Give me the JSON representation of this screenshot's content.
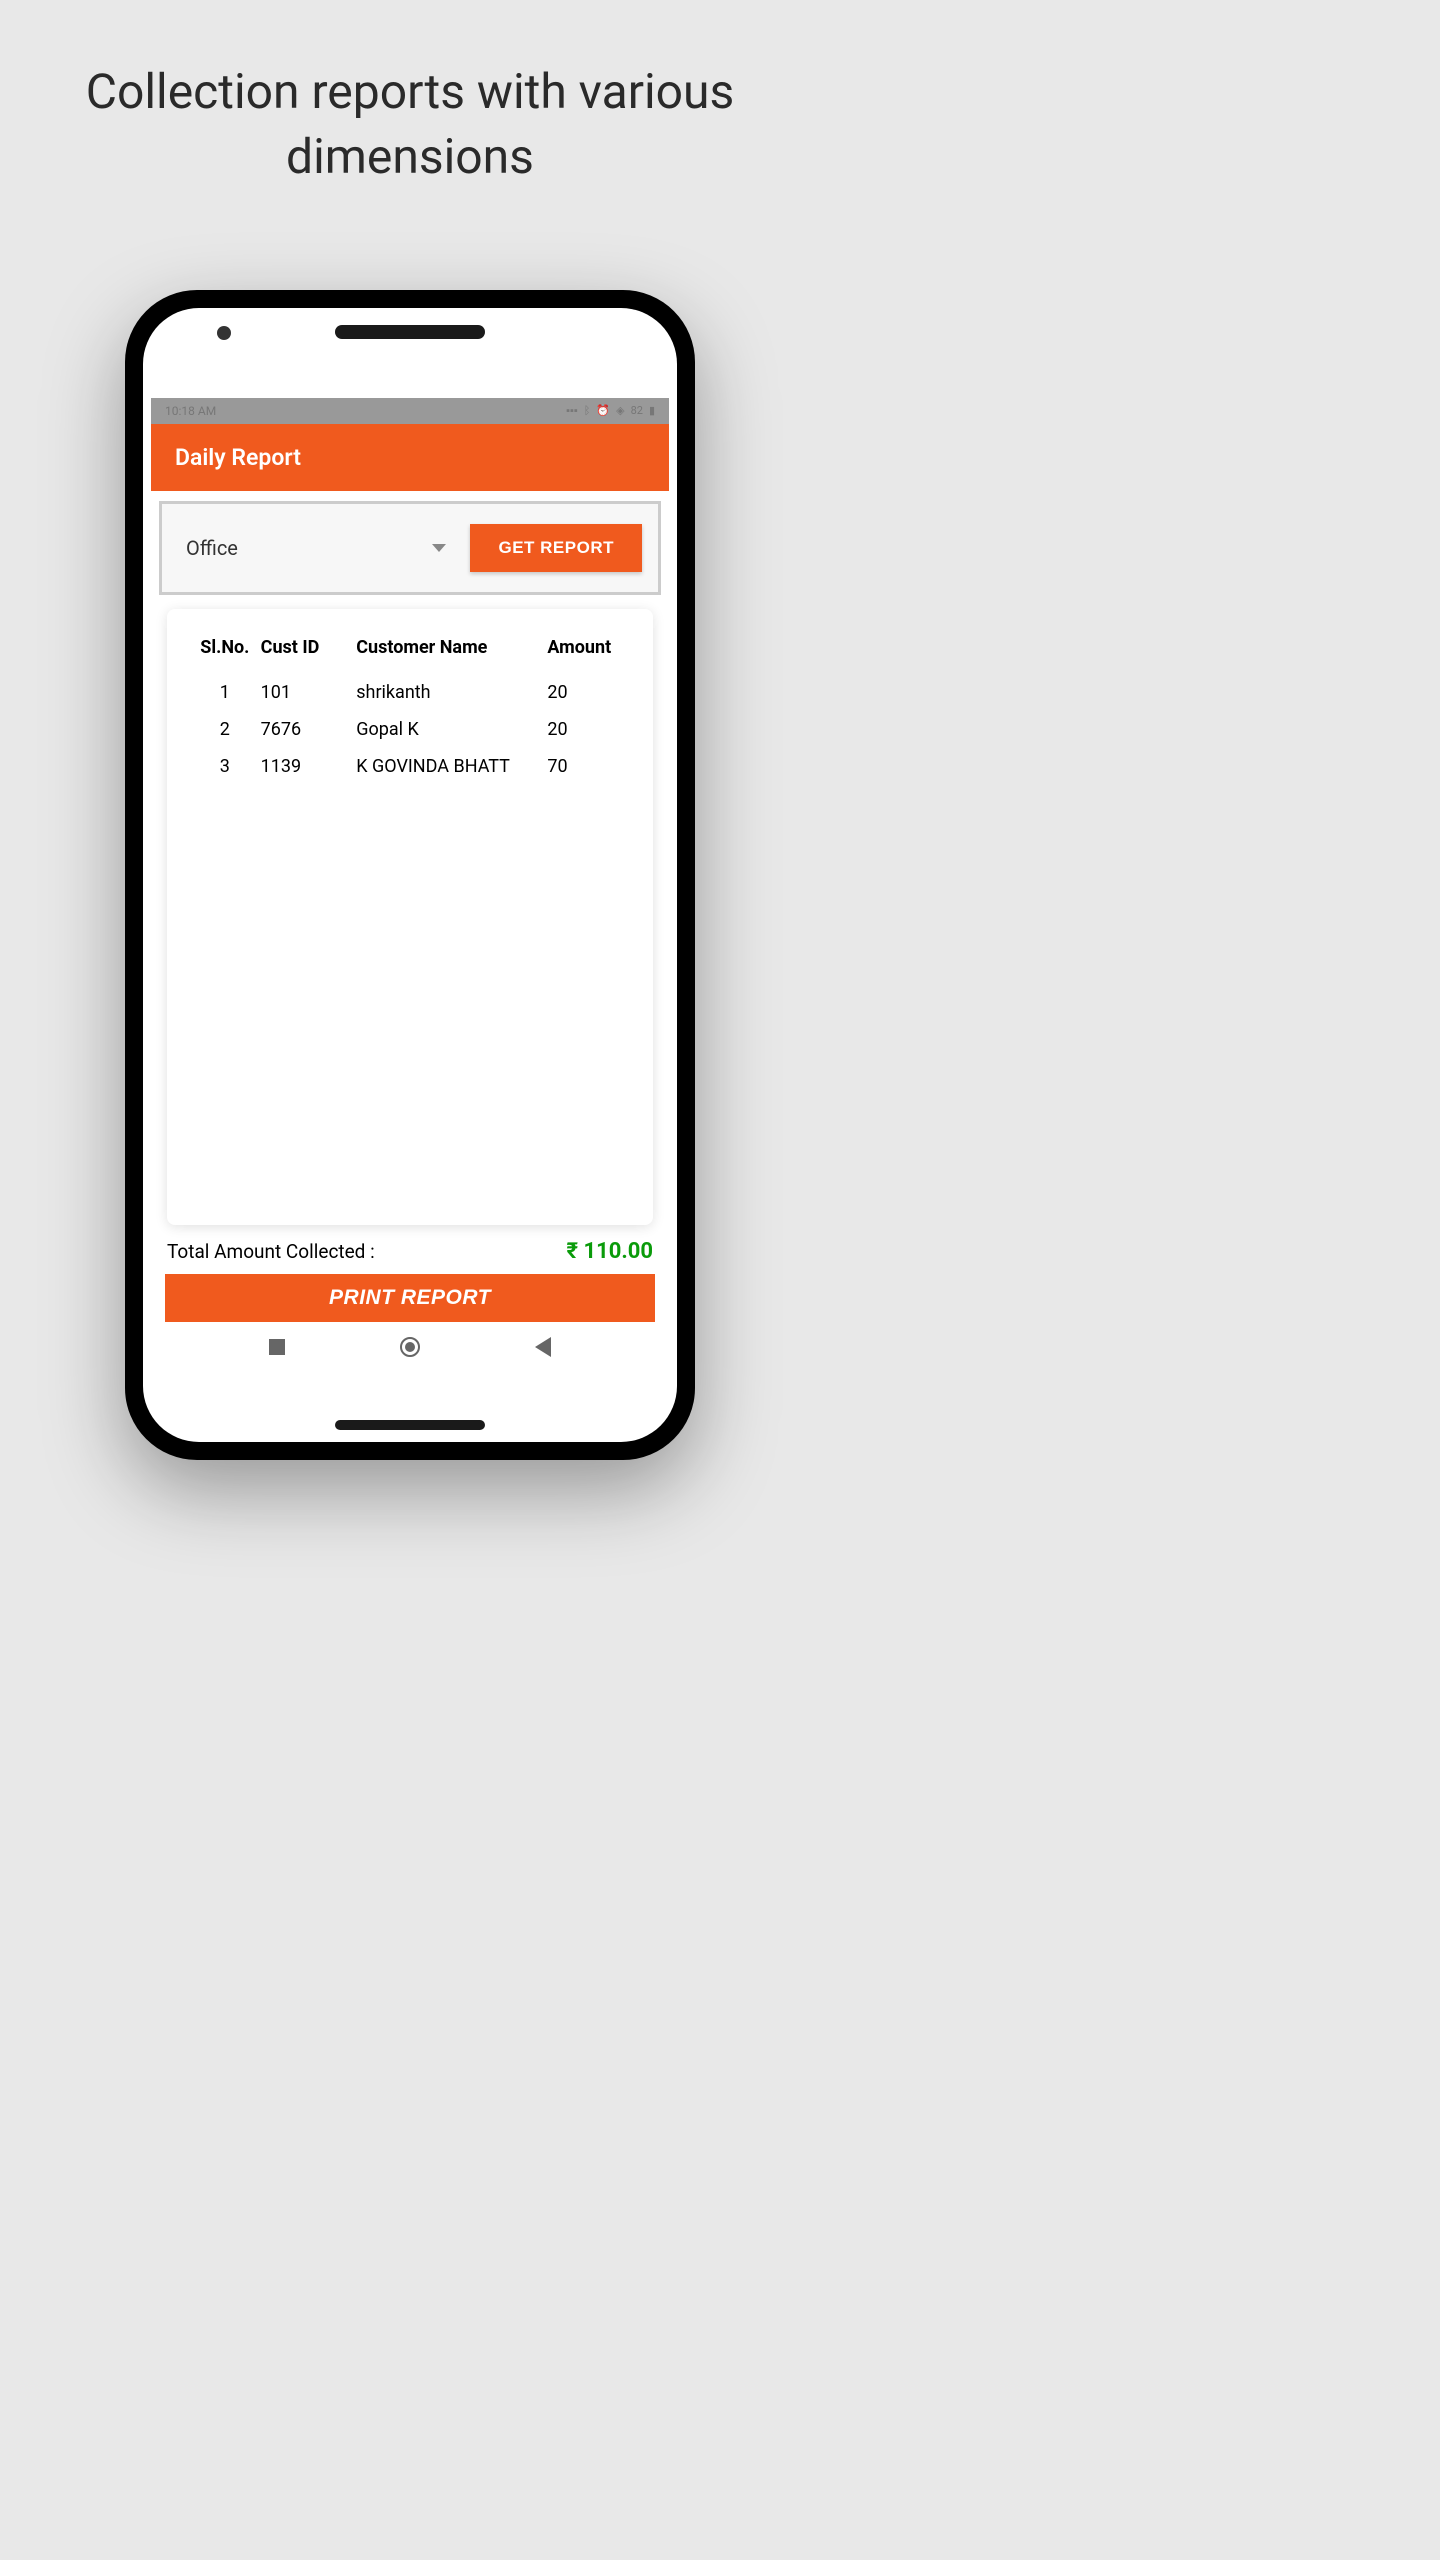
{
  "marketing": {
    "headline": "Collection reports with various dimensions"
  },
  "statusBar": {
    "time": "10:18 AM",
    "battery": "82"
  },
  "appBar": {
    "title": "Daily Report"
  },
  "filter": {
    "dropdown": {
      "selected": "Office"
    },
    "button": "GET REPORT"
  },
  "table": {
    "headers": {
      "sl": "Sl.No.",
      "custId": "Cust ID",
      "name": "Customer Name",
      "amount": "Amount"
    },
    "rows": [
      {
        "sl": "1",
        "custId": "101",
        "name": "shrikanth",
        "amount": "20"
      },
      {
        "sl": "2",
        "custId": "7676",
        "name": "Gopal K",
        "amount": "20"
      },
      {
        "sl": "3",
        "custId": "1139",
        "name": "K GOVINDA BHATT",
        "amount": "70"
      }
    ]
  },
  "total": {
    "label": "Total Amount Collected :",
    "amount": "₹ 110.00"
  },
  "printButton": "PRINT REPORT"
}
